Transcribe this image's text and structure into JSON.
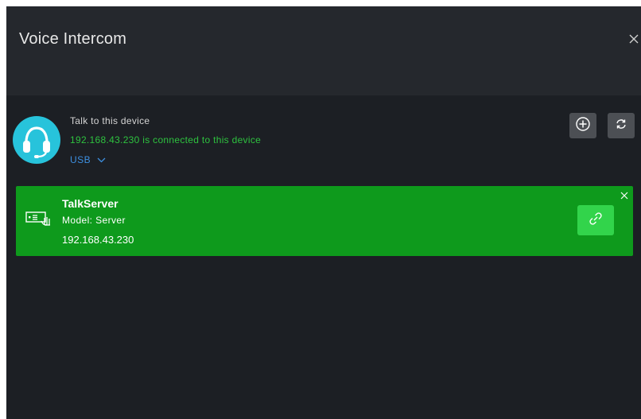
{
  "window": {
    "title": "Voice Intercom"
  },
  "talk": {
    "label": "Talk to this device",
    "status": "192.168.43.230 is connected to this device",
    "audio_source": "USB"
  },
  "device": {
    "name": "TalkServer",
    "model": "Model:  Server",
    "ip": "192.168.43.230"
  },
  "colors": {
    "background": "#1c1f24",
    "titlebar": "#25282d",
    "accent_cyan": "#27c3db",
    "status_green": "#2ec23f",
    "link_blue": "#3d8fe0",
    "card_green": "#0e9a1c",
    "link_button_green": "#32d44b"
  },
  "icons": {
    "close": "close-icon",
    "headset": "headset-icon",
    "chevron": "chevron-down-icon",
    "add": "add-circle-icon",
    "refresh": "refresh-icon",
    "device": "server-device-icon",
    "link": "link-icon"
  }
}
